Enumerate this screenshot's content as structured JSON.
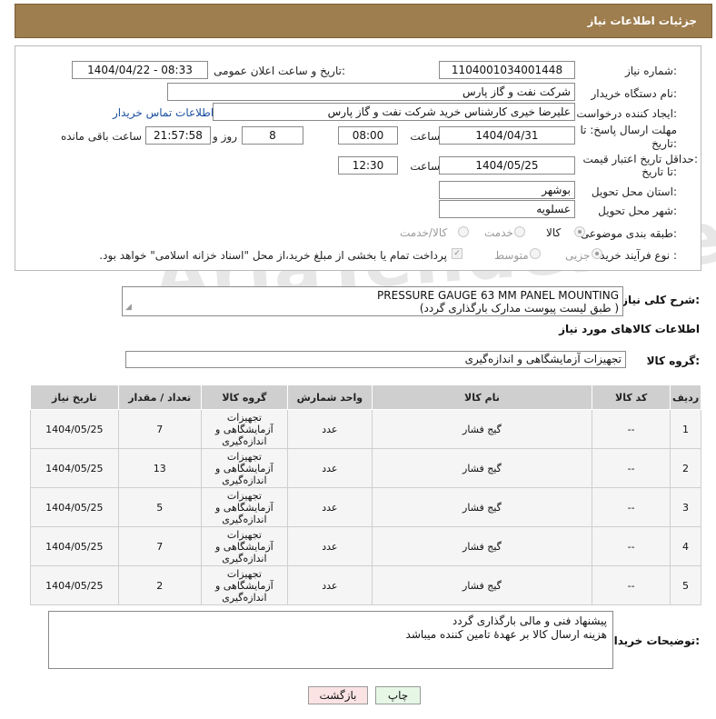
{
  "header": {
    "title": "جزئیات اطلاعات نیاز"
  },
  "form": {
    "need_number_label": "شماره نیاز:",
    "need_number": "1104001034001448",
    "announce_label": "تاریخ و ساعت اعلان عمومی:",
    "announce_value": "1404/04/22 - 08:33",
    "buyer_label": "نام دستگاه خریدار:",
    "buyer_value": "شرکت نفت و گاز پارس",
    "creator_label": "ایجاد کننده درخواست:",
    "creator_value": "علیرضا  خیری کارشناس خرید  شرکت نفت و گاز پارس",
    "contact_link": "اطلاعات تماس خریدار",
    "deadline_label_1": "مهلت ارسال پاسخ: تا",
    "deadline_label_2": "تاریخ:",
    "deadline_date": "1404/04/31",
    "time_label": "ساعت",
    "deadline_time": "08:00",
    "days_value": "8",
    "days_label": "روز و",
    "remaining_value": "21:57:58",
    "remaining_label": "ساعت باقی مانده",
    "validity_label_1": "حداقل تاریخ اعتبار قیمت:",
    "validity_label_2": "تا تاریخ:",
    "validity_date": "1404/05/25",
    "validity_time_label": "ساعت",
    "validity_time": "12:30",
    "province_label": "استان محل تحویل:",
    "province_value": "بوشهر",
    "city_label": "شهر محل تحویل:",
    "city_value": "عسلویه",
    "category_label": "طبقه بندی موضوعی:",
    "category_options": [
      "کالا",
      "خدمت",
      "کالا/خدمت"
    ],
    "purchase_label": "نوع فرآیند خرید :",
    "purchase_options": [
      "جزیی",
      "متوسط"
    ],
    "payment_note": "پرداخت تمام یا بخشی از مبلغ خرید،از محل \"اسناد خزانه اسلامی\" خواهد بود."
  },
  "description": {
    "label": "شرح کلی نیاز:",
    "line1": "PRESSURE GAUGE 63 MM PANEL MOUNTING",
    "line2": "( طبق لیست پیوست مدارک بارگذاری گردد)"
  },
  "goods": {
    "section_title": "اطلاعات کالاهای مورد نیاز",
    "group_label": "گروه کالا:",
    "group_value": "تجهیزات آزمایشگاهی و اندازه‌گیری",
    "columns": [
      "ردیف",
      "کد کالا",
      "نام کالا",
      "واحد شمارش",
      "گروه کالا",
      "تعداد / مقدار",
      "تاریخ نیاز"
    ],
    "rows": [
      {
        "row": "1",
        "code": "--",
        "name": "گیج فشار",
        "unit": "عدد",
        "group": "تجهیزات آزمایشگاهی و اندازه‌گیری",
        "qty": "7",
        "date": "1404/05/25"
      },
      {
        "row": "2",
        "code": "--",
        "name": "گیج فشار",
        "unit": "عدد",
        "group": "تجهیزات آزمایشگاهی و اندازه‌گیری",
        "qty": "13",
        "date": "1404/05/25"
      },
      {
        "row": "3",
        "code": "--",
        "name": "گیج فشار",
        "unit": "عدد",
        "group": "تجهیزات آزمایشگاهی و اندازه‌گیری",
        "qty": "5",
        "date": "1404/05/25"
      },
      {
        "row": "4",
        "code": "--",
        "name": "گیج فشار",
        "unit": "عدد",
        "group": "تجهیزات آزمایشگاهی و اندازه‌گیری",
        "qty": "7",
        "date": "1404/05/25"
      },
      {
        "row": "5",
        "code": "--",
        "name": "گیج فشار",
        "unit": "عدد",
        "group": "تجهیزات آزمایشگاهی و اندازه‌گیری",
        "qty": "2",
        "date": "1404/05/25"
      }
    ]
  },
  "buyer_notes": {
    "label": "توضیحات خریدار:",
    "line1": "پیشنهاد فنی و مالی بارگذاری گردد",
    "line2": "هزینه ارسال کالا بر عهدهٔ تامین کننده میباشد"
  },
  "buttons": {
    "print": "چاپ",
    "back": "بازگشت"
  },
  "watermark": "AriaTender.neT",
  "colors": {
    "header": "#9e7d4e",
    "table_header": "#cfcfcf",
    "print_btn": "#e6f7e6",
    "back_btn": "#fbe3e3"
  }
}
